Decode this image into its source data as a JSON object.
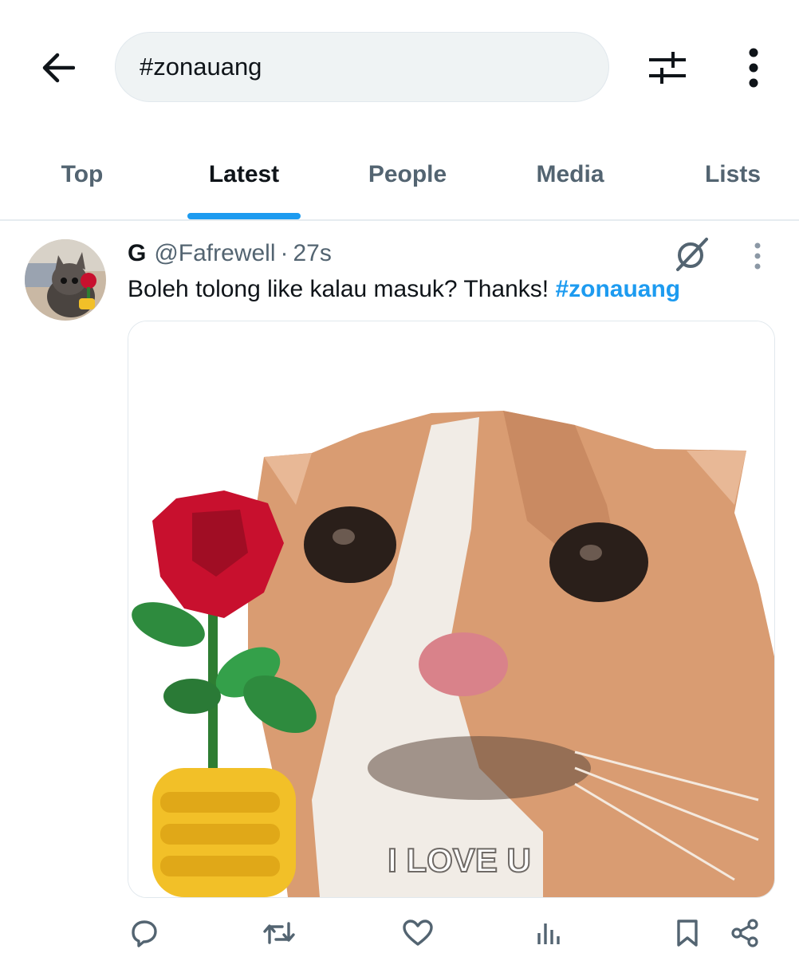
{
  "search": {
    "query": "#zonauang"
  },
  "tabs": [
    {
      "label": "Top",
      "active": false
    },
    {
      "label": "Latest",
      "active": true
    },
    {
      "label": "People",
      "active": false
    },
    {
      "label": "Media",
      "active": false
    },
    {
      "label": "Lists",
      "active": false
    }
  ],
  "tweet": {
    "display_name": "G",
    "handle": "@Fafrewell",
    "separator": "·",
    "time": "27s",
    "text": "Boleh tolong like kalau masuk? Thanks!",
    "hashtag": "#zonauang",
    "media_caption": "I LOVE U"
  },
  "colors": {
    "accent": "#1d9bf0",
    "text": "#0f1419",
    "muted": "#536471",
    "search_bg": "#eff3f4"
  },
  "icons": {
    "back": "arrow-left-icon",
    "filter": "sliders-icon",
    "more": "vertical-dots-icon",
    "grok": "grok-icon",
    "reply": "reply-icon",
    "retweet": "retweet-icon",
    "like": "heart-icon",
    "views": "views-icon",
    "bookmark": "bookmark-icon",
    "share": "share-icon"
  }
}
